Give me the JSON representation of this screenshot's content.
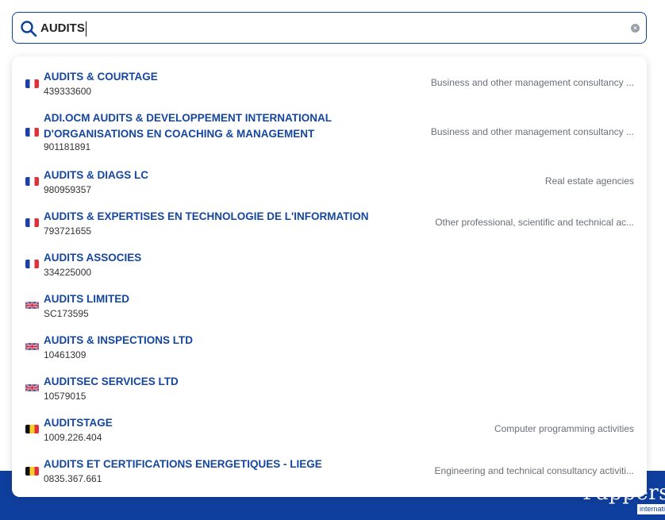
{
  "search": {
    "value": "AUDITS",
    "placeholder": ""
  },
  "brand": {
    "name": "Pappers",
    "sub": "international"
  },
  "colors": {
    "accent": "#0f3f9e",
    "link": "#1546a0",
    "muted": "#6b6f76"
  },
  "results": [
    {
      "flag": "france-flag-icon",
      "name": "AUDITS & COURTAGE",
      "id": "439333600",
      "activity": "Business and other management consultancy ..."
    },
    {
      "flag": "france-flag-icon",
      "name": "ADI.OCM AUDITS & DEVELOPPEMENT INTERNATIONAL D'ORGANISATIONS EN COACHING & MANAGEMENT",
      "id": "901181891",
      "activity": "Business and other management consultancy ..."
    },
    {
      "flag": "france-flag-icon",
      "name": "AUDITS & DIAGS LC",
      "id": "980959357",
      "activity": "Real estate agencies"
    },
    {
      "flag": "france-flag-icon",
      "name": "AUDITS & EXPERTISES EN TECHNOLOGIE DE L'INFORMATION",
      "id": "793721655",
      "activity": "Other professional, scientific and technical ac..."
    },
    {
      "flag": "france-flag-icon",
      "name": "AUDITS ASSOCIES",
      "id": "334225000",
      "activity": ""
    },
    {
      "flag": "uk-flag-icon",
      "name": "AUDITS LIMITED",
      "id": "SC173595",
      "activity": ""
    },
    {
      "flag": "uk-flag-icon",
      "name": "AUDITS & INSPECTIONS LTD",
      "id": "10461309",
      "activity": ""
    },
    {
      "flag": "uk-flag-icon",
      "name": "AUDITSEC SERVICES LTD",
      "id": "10579015",
      "activity": ""
    },
    {
      "flag": "belgium-flag-icon",
      "name": "AUDITSTAGE",
      "id": "1009.226.404",
      "activity": "Computer programming activities"
    },
    {
      "flag": "belgium-flag-icon",
      "name": "AUDITS ET CERTIFICATIONS ENERGETIQUES - LIEGE",
      "id": "0835.367.661",
      "activity": "Engineering and technical consultancy activiti..."
    }
  ]
}
